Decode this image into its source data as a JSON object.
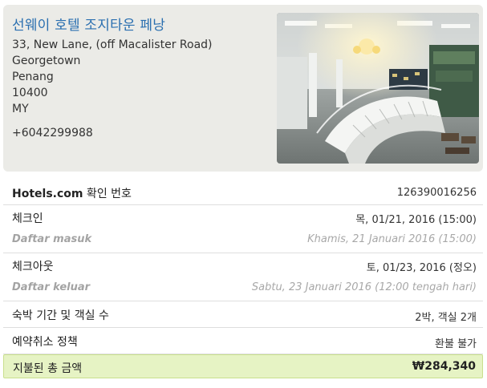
{
  "hotel": {
    "name": "선웨이 호텔 조지타운 페낭",
    "address_line1": "33, New Lane, (off Macalister Road)",
    "city": "Georgetown",
    "state": "Penang",
    "postal_code": "10400",
    "country": "MY",
    "phone": "+6042299988",
    "photo_icon": "hotel-lobby-photo"
  },
  "details": {
    "confirmation": {
      "label_brand": "Hotels.com",
      "label_rest": " 확인 번호",
      "value": "126390016256"
    },
    "checkin": {
      "label": "체크인",
      "value": "목, 01/21, 2016 (15:00)",
      "label_alt": "Daftar masuk",
      "value_alt": "Khamis, 21 Januari 2016 (15:00)"
    },
    "checkout": {
      "label": "체크아웃",
      "value": "토, 01/23, 2016 (정오)",
      "label_alt": "Daftar keluar",
      "value_alt": "Sabtu, 23 Januari 2016 (12:00 tengah hari)"
    },
    "stay": {
      "label": "숙박 기간 및 객실 수",
      "value": "2박, 객실 2개"
    },
    "cancellation": {
      "label": "예약취소 정책",
      "value": "환불 불가"
    },
    "total": {
      "label": "지불된 총 금액",
      "value": "₩284,340"
    }
  },
  "colors": {
    "hotel_name": "#2a6fb0",
    "card_bg": "#ebebe7",
    "total_bg": "#e6f3c4"
  }
}
